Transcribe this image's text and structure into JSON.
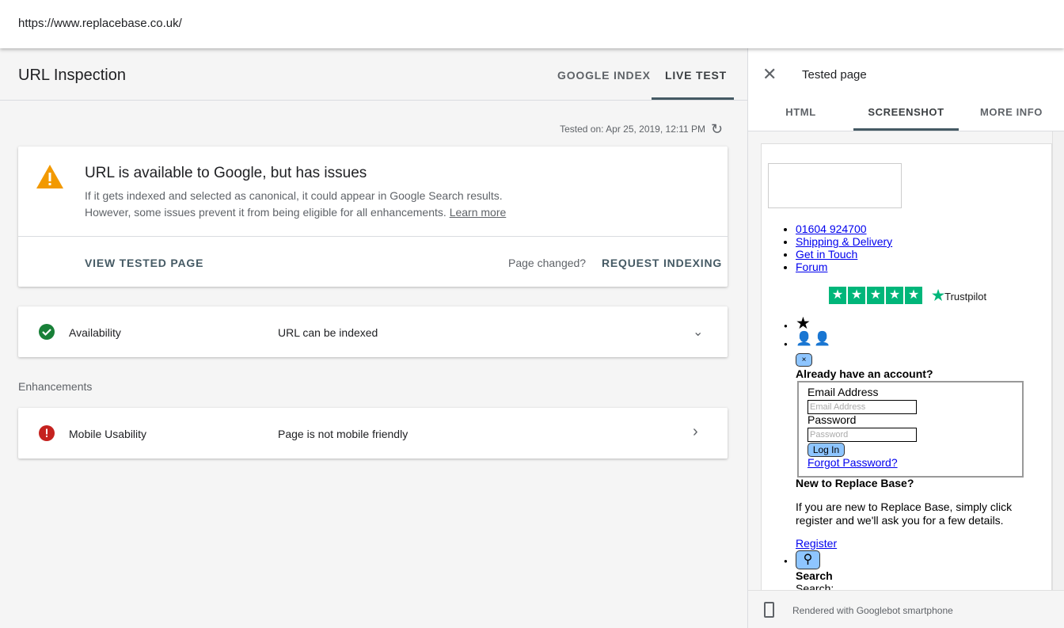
{
  "address_bar": {
    "url": "https://www.replacebase.co.uk/"
  },
  "header": {
    "title": "URL Inspection",
    "tabs": [
      {
        "label": "GOOGLE INDEX"
      },
      {
        "label": "LIVE TEST",
        "active": true
      }
    ]
  },
  "tested_on": "Tested on: Apr 25, 2019, 12:11 PM",
  "status_card": {
    "title": "URL is available to Google, but has issues",
    "line1": "If it gets indexed and selected as canonical, it could appear in Google Search results.",
    "line2": "However, some issues prevent it from being eligible for all enhancements.",
    "learn_more": "Learn more",
    "view_tested_page": "VIEW TESTED PAGE",
    "page_changed": "Page changed?",
    "request_indexing": "REQUEST INDEXING"
  },
  "availability": {
    "label": "Availability",
    "value": "URL can be indexed"
  },
  "enhancements": {
    "heading": "Enhancements",
    "items": [
      {
        "label": "Mobile Usability",
        "value": "Page is not mobile friendly"
      }
    ]
  },
  "colors": {
    "warning": "#f29900",
    "success": "#188038",
    "error": "#c5221f",
    "trustpilot": "#00b67a"
  },
  "panel": {
    "title": "Tested page",
    "tabs": [
      {
        "label": "HTML"
      },
      {
        "label": "SCREENSHOT",
        "active": true
      },
      {
        "label": "MORE INFO"
      }
    ],
    "footer": "Rendered with Googlebot smartphone",
    "screenshot": {
      "links": [
        "01604 924700",
        "Shipping & Delivery",
        "Get in Touch",
        "Forum"
      ],
      "trustpilot": "Trustpilot",
      "close_btn": "×",
      "account_heading": "Already have an account?",
      "email_label": "Email Address",
      "email_placeholder": "Email Address",
      "password_label": "Password",
      "password_placeholder": "Password",
      "login_btn": "Log In",
      "forgot": "Forgot Password?",
      "new_heading": "New to Replace Base?",
      "new_text": "If you are new to Replace Base, simply click register and we'll ask you for a few details.",
      "register": "Register",
      "search_heading": "Search",
      "search_label": "Search:"
    }
  }
}
